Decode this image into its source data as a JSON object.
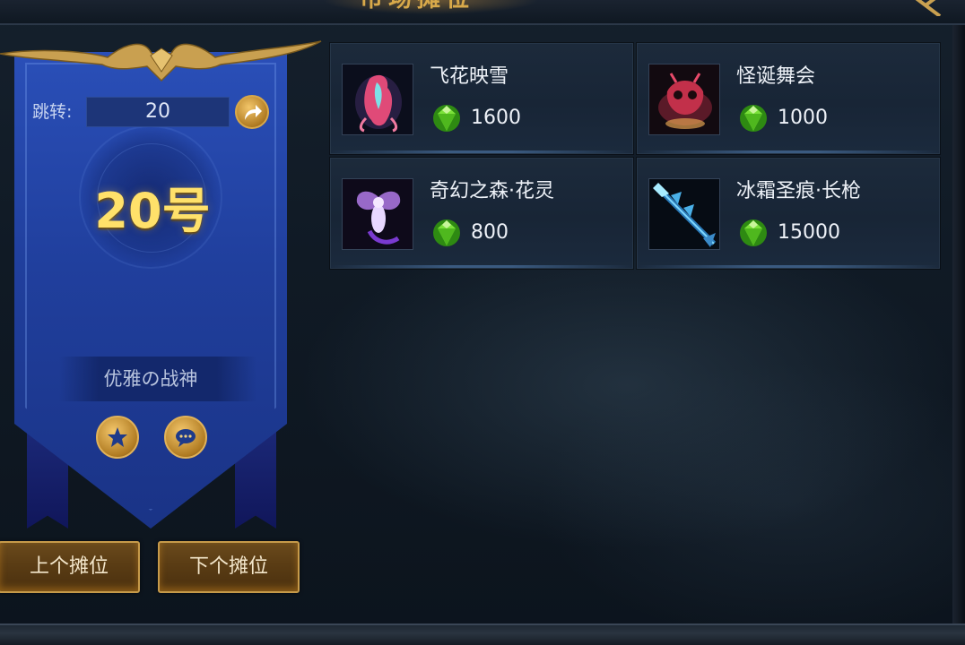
{
  "header": {
    "title": "市场摊位"
  },
  "stall": {
    "jump_label": "跳转:",
    "jump_value": "20",
    "number": "20号",
    "owner": "优雅の战神"
  },
  "nav": {
    "prev_label": "上个摊位",
    "next_label": "下个摊位"
  },
  "items": [
    {
      "name": "飞花映雪",
      "price": "1600",
      "icon": "pink-costume-icon"
    },
    {
      "name": "怪诞舞会",
      "price": "1000",
      "icon": "red-mask-icon"
    },
    {
      "name": "奇幻之森·花灵",
      "price": "800",
      "icon": "purple-fairy-icon"
    },
    {
      "name": "冰霜圣痕·长枪",
      "price": "15000",
      "icon": "ice-spear-icon"
    }
  ],
  "colors": {
    "gold": "#d8a84a",
    "banner_blue": "#203f9d",
    "number_yellow": "#ffe16a",
    "gem_green": "#6bd12a"
  }
}
